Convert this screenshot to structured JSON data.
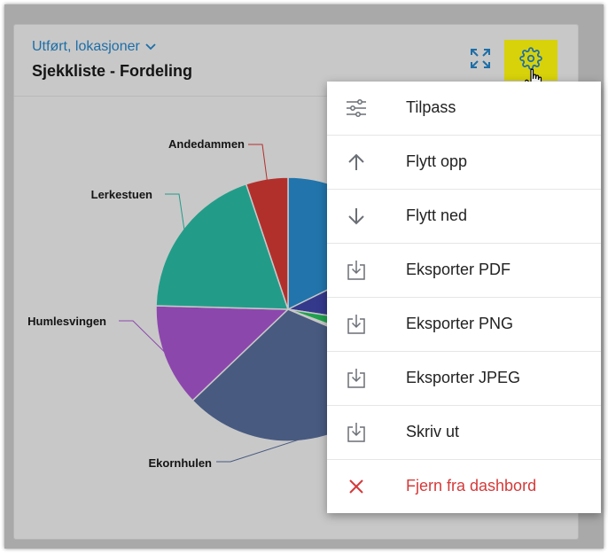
{
  "widget": {
    "dataset_label": "Utført, lokasjoner",
    "title": "Sjekkliste - Fordeling"
  },
  "chart_data": {
    "type": "pie",
    "slices": [
      {
        "label": "",
        "value": 15.5,
        "color": "#2175ac"
      },
      {
        "label": "",
        "value": 8.5,
        "color": "#34398c"
      },
      {
        "label": "",
        "value": 2.8,
        "color": "#1fa14e"
      },
      {
        "label": "",
        "value": 0.7,
        "color": "#c8c8c8"
      },
      {
        "label": "Ekornhulen",
        "value": 27.5,
        "color": "#485a80"
      },
      {
        "label": "Humlesvingen",
        "value": 11.0,
        "color": "#8c47ad"
      },
      {
        "label": "Lerkestuen",
        "value": 17.0,
        "color": "#229c89"
      },
      {
        "label": "Andedammen",
        "value": 4.5,
        "color": "#b2302c"
      }
    ]
  },
  "menu": {
    "items": [
      {
        "label": "Tilpass",
        "icon": "sliders-icon"
      },
      {
        "label": "Flytt opp",
        "icon": "arrow-up-icon"
      },
      {
        "label": "Flytt ned",
        "icon": "arrow-down-icon"
      },
      {
        "label": "Eksporter PDF",
        "icon": "download-icon"
      },
      {
        "label": "Eksporter PNG",
        "icon": "download-icon"
      },
      {
        "label": "Eksporter JPEG",
        "icon": "download-icon"
      },
      {
        "label": "Skriv ut",
        "icon": "download-icon"
      },
      {
        "label": "Fjern fra dashbord",
        "icon": "close-icon"
      }
    ]
  },
  "colors": {
    "accent": "#1d6ea8",
    "settings_highlight": "#d7d20a",
    "danger": "#d43a3a"
  }
}
